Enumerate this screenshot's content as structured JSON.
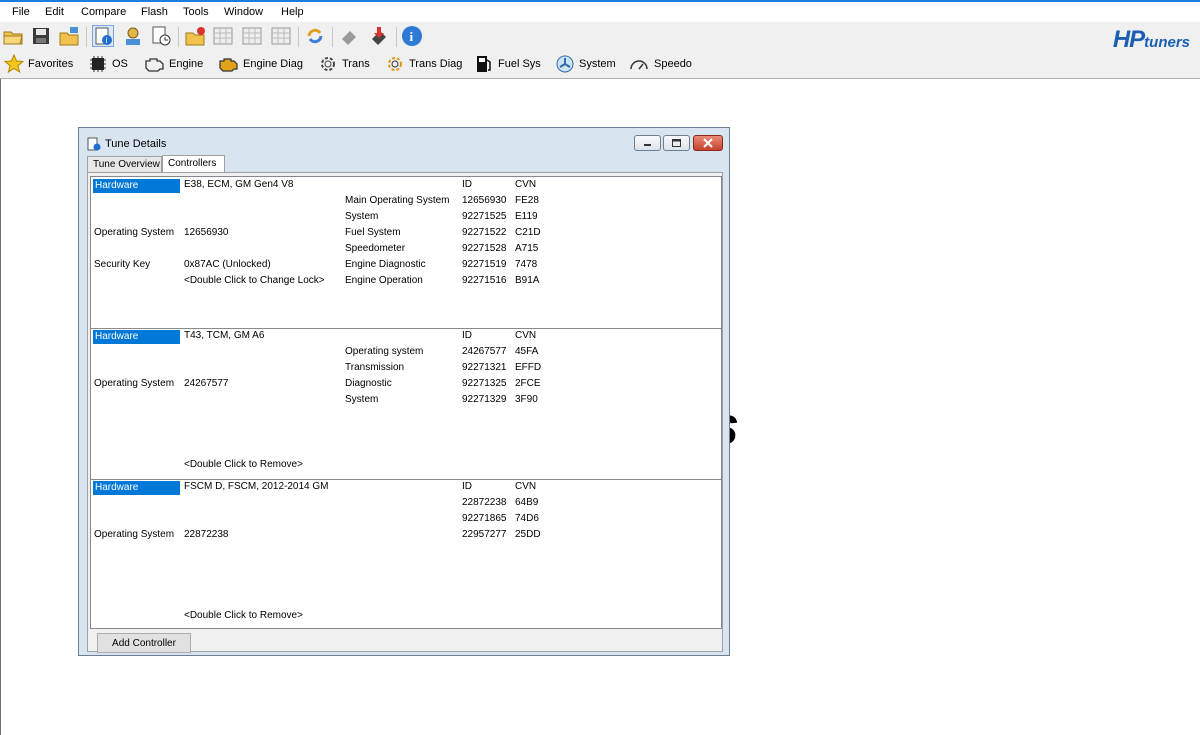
{
  "menu": [
    "File",
    "Edit",
    "Compare",
    "Flash",
    "Tools",
    "Window",
    "Help"
  ],
  "toolbar_icons": [
    "open-folder-icon",
    "save-icon",
    "open-recent-icon",
    "tune-info-icon",
    "vehicle-info-icon",
    "history-icon",
    "new-folder-icon",
    "table-icon",
    "table2-icon",
    "table3-icon",
    "refresh-icon",
    "eraser-icon",
    "flash-chip-icon",
    "info-icon"
  ],
  "logo": {
    "hp": "HP",
    "tuners": "tuners"
  },
  "quick_bar": [
    {
      "label": "Favorites",
      "icon": "star-icon"
    },
    {
      "label": "OS",
      "icon": "chip-icon"
    },
    {
      "label": "Engine",
      "icon": "engine-icon"
    },
    {
      "label": "Engine Diag",
      "icon": "check-engine-icon"
    },
    {
      "label": "Trans",
      "icon": "gear-icon"
    },
    {
      "label": "Trans Diag",
      "icon": "gear-diag-icon"
    },
    {
      "label": "Fuel Sys",
      "icon": "fuel-pump-icon"
    },
    {
      "label": "System",
      "icon": "fan-icon"
    },
    {
      "label": "Speedo",
      "icon": "speedometer-icon"
    }
  ],
  "background_text": "rs",
  "dialog": {
    "title": "Tune Details",
    "tabs": [
      "Tune Overview",
      "Controllers"
    ],
    "active_tab": "Controllers",
    "add_button": "Add Controller",
    "col_id": "ID",
    "col_cvn": "CVN",
    "controllers": [
      {
        "hardware_label": "Hardware",
        "hardware": "E38, ECM, GM Gen4 V8",
        "os_label": "Operating System",
        "os": "12656930",
        "security_label": "Security Key",
        "security": "0x87AC (Unlocked)",
        "action": "<Double Click to Change Lock>",
        "modules": [
          {
            "name": "Main Operating System",
            "id": "12656930",
            "cvn": "FE28"
          },
          {
            "name": "System",
            "id": "92271525",
            "cvn": "E119"
          },
          {
            "name": "Fuel System",
            "id": "92271522",
            "cvn": "C21D"
          },
          {
            "name": "Speedometer",
            "id": "92271528",
            "cvn": "A715"
          },
          {
            "name": "Engine Diagnostic",
            "id": "92271519",
            "cvn": "7478"
          },
          {
            "name": "Engine Operation",
            "id": "92271516",
            "cvn": "B91A"
          }
        ]
      },
      {
        "hardware_label": "Hardware",
        "hardware": "T43, TCM, GM A6",
        "os_label": "Operating System",
        "os": "24267577",
        "action": "<Double Click to Remove>",
        "modules": [
          {
            "name": "Operating system",
            "id": "24267577",
            "cvn": "45FA"
          },
          {
            "name": "Transmission",
            "id": "92271321",
            "cvn": "EFFD"
          },
          {
            "name": "Diagnostic",
            "id": "92271325",
            "cvn": "2FCE"
          },
          {
            "name": "System",
            "id": "92271329",
            "cvn": "3F90"
          }
        ]
      },
      {
        "hardware_label": "Hardware",
        "hardware": "FSCM D, FSCM, 2012-2014 GM",
        "os_label": "Operating System",
        "os": "22872238",
        "action": "<Double Click to Remove>",
        "modules": [
          {
            "name": "",
            "id": "22872238",
            "cvn": "64B9"
          },
          {
            "name": "",
            "id": "92271865",
            "cvn": "74D6"
          },
          {
            "name": "",
            "id": "22957277",
            "cvn": "25DD"
          }
        ]
      }
    ]
  }
}
